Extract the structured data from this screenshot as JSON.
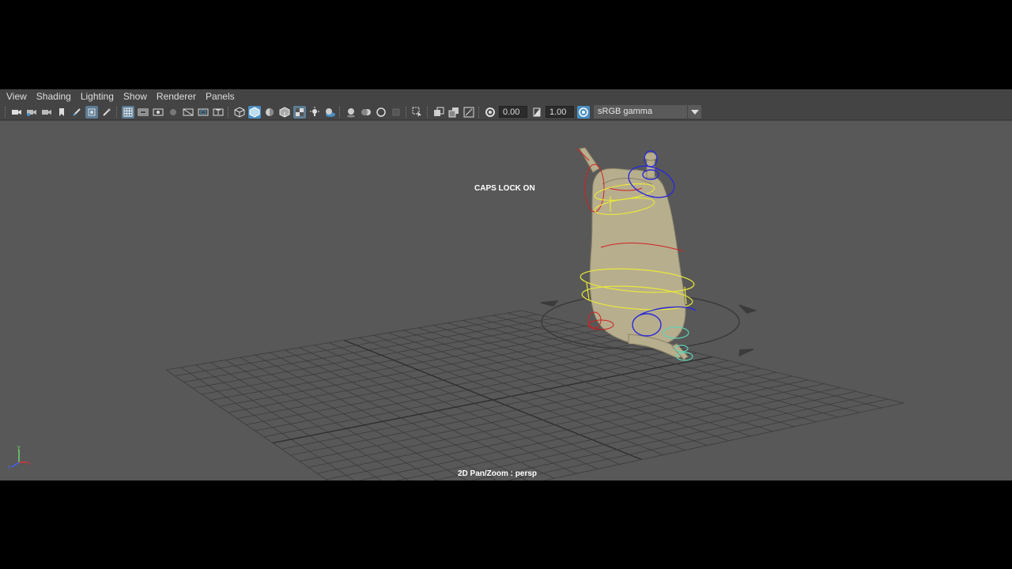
{
  "menu": {
    "items": [
      "View",
      "Shading",
      "Lighting",
      "Show",
      "Renderer",
      "Panels"
    ]
  },
  "toolbar": {
    "exposure_value": "0.00",
    "gamma_value": "1.00",
    "color_space": "sRGB gamma",
    "icons_group1": [
      "camera-icon",
      "camera-attributes-icon",
      "camera-bookmark-icon",
      "image-plane-icon",
      "grease-pencil-icon",
      "2d-pan-zoom-icon",
      "camera-lock-icon"
    ],
    "icons_group2": [
      "grid-icon",
      "film-gate-icon",
      "resolution-gate-icon",
      "gate-mask-icon",
      "field-chart-icon",
      "safe-action-icon"
    ],
    "icons_group3": [
      "wireframe-icon",
      "smooth-shade-icon",
      "default-material-icon",
      "wireframe-on-shaded-icon",
      "textured-icon",
      "use-lights-icon",
      "shadows-icon"
    ],
    "icons_group4": [
      "screen-space-ao-icon",
      "motion-blur-icon",
      "anti-aliasing-icon",
      "depth-of-field-icon"
    ],
    "icons_group5": [
      "isolate-select-icon",
      "xray-icon",
      "xray-active-components-icon",
      "xray-joints-icon"
    ]
  },
  "viewport": {
    "hud_caps": "CAPS LOCK ON",
    "hud_camera": "2D Pan/Zoom : persp",
    "axis_labels": {
      "x": "x",
      "y": "y",
      "z": "z"
    },
    "colors": {
      "background": "#585858",
      "grid": "#3c3c3c",
      "mesh": "#b7ae8e",
      "ctrl_red": "#d22020",
      "ctrl_blue": "#2a2ad8",
      "ctrl_yellow": "#e8e83a",
      "ctrl_cyan": "#5fd3b4"
    }
  }
}
